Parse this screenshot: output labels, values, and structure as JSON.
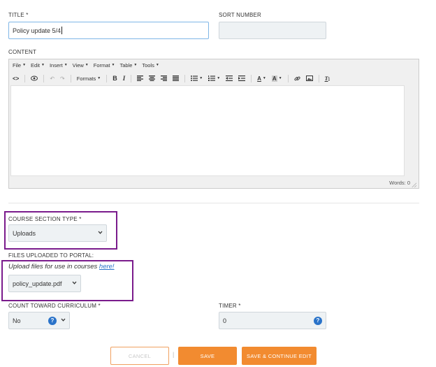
{
  "title_field": {
    "label": "TITLE *",
    "value": "Policy update 5/4"
  },
  "sort_field": {
    "label": "SORT NUMBER",
    "value": ""
  },
  "content": {
    "label": "CONTENT",
    "menu": [
      "File",
      "Edit",
      "Insert",
      "View",
      "Format",
      "Table",
      "Tools"
    ],
    "formats_label": "Formats",
    "words_label": "Words: 0"
  },
  "course_section": {
    "label": "COURSE SECTION TYPE *",
    "value": "Uploads"
  },
  "files": {
    "label": "FILES UPLOADED TO PORTAL:",
    "helper_text": "Upload files for use in courses",
    "helper_link": "here!",
    "value": "policy_update.pdf"
  },
  "count_curriculum": {
    "label": "COUNT TOWARD CURRICULUM *",
    "value": "No"
  },
  "timer": {
    "label": "TIMER *",
    "value": "0"
  },
  "buttons": {
    "cancel": "CANCEL",
    "separator": "|",
    "save": "SAVE",
    "save_continue": "SAVE & CONTINUE EDIT"
  },
  "colors": {
    "accent": "#f28b30",
    "highlight": "#7a1b8c",
    "help": "#2a73c9",
    "link": "#2a73c9"
  }
}
